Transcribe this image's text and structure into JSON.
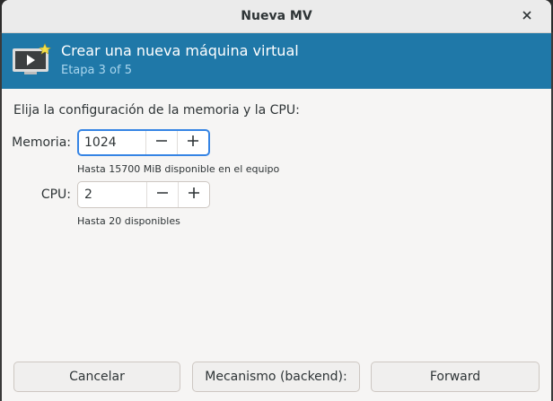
{
  "window": {
    "title": "Nueva MV"
  },
  "banner": {
    "title": "Crear una nueva máquina virtual",
    "subtitle": "Etapa 3 of 5"
  },
  "form": {
    "instruction": "Elija la configuración de la memoria y la CPU:",
    "memory": {
      "label": "Memoria:",
      "value": "1024",
      "hint": "Hasta 15700 MiB disponible en el equipo"
    },
    "cpu": {
      "label": "CPU:",
      "value": "2",
      "hint": "Hasta 20 disponibles"
    }
  },
  "footer": {
    "cancel_label": "Cancelar",
    "backend_label": "Mecanismo (backend):",
    "forward_label": "Forward"
  },
  "icons": {
    "close": "close-icon",
    "banner": "virtual-machine-icon",
    "minus": "minus-icon",
    "plus": "plus-icon"
  },
  "colors": {
    "banner_bg": "#1f78a8",
    "accent_focus": "#3584e4",
    "subtitle": "#a9d6ee"
  }
}
